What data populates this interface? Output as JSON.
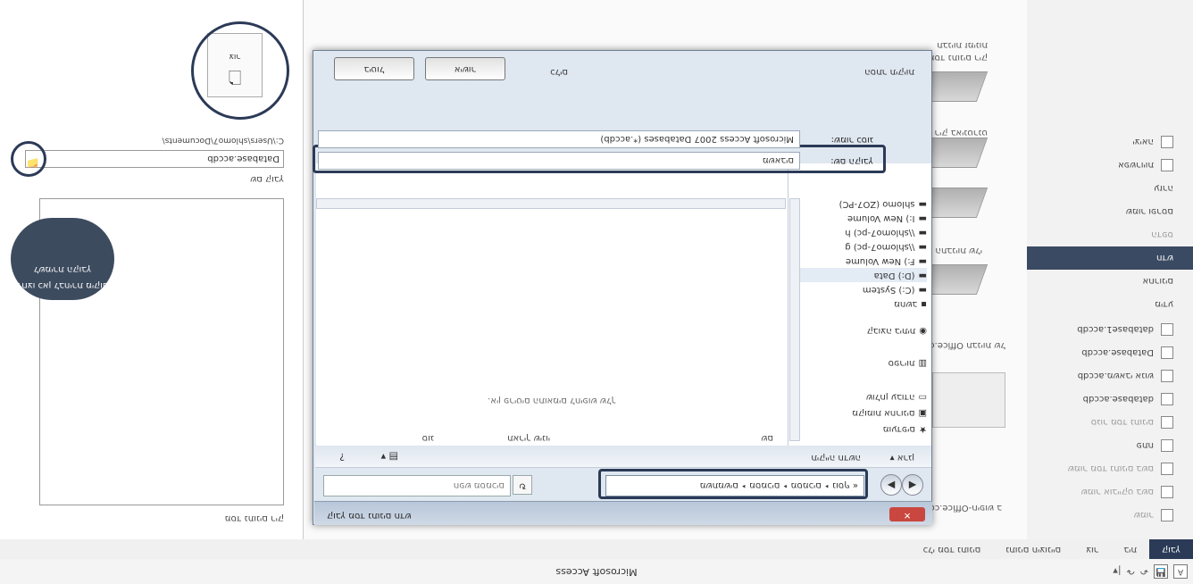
{
  "app_title": "Microsoft Access",
  "quick_access": [
    "A",
    "💾",
    "↶",
    "↷",
    "|▾"
  ],
  "ribbon_tabs": [
    {
      "label": "קובץ",
      "active": true
    },
    {
      "label": "בית"
    },
    {
      "label": "צור"
    },
    {
      "label": "נתונים חיצוניים"
    },
    {
      "label": "כלי מסד נתונים"
    }
  ],
  "left_pane": {
    "items": [
      {
        "label": "שמור",
        "icon": "save-icon"
      },
      {
        "label": "שמור אובייקט בשם",
        "icon": "save-as-icon"
      },
      {
        "label": "שמור מסד נתונים בשם",
        "icon": "save-db-icon"
      },
      {
        "label": "פתח",
        "icon": "open-icon"
      },
      {
        "label": "סגור מסד נתונים",
        "icon": "close-db-icon"
      },
      {
        "label": "database.accdb",
        "icon": "db-file-icon"
      },
      {
        "label": "משאבי אנוש.accdb",
        "icon": "db-file-icon"
      },
      {
        "label": "Database.accdb",
        "icon": "db-file-icon"
      },
      {
        "label": "database1.accdb",
        "icon": "db-file-icon"
      },
      {
        "label": "מידע"
      },
      {
        "label": "אחרונים"
      },
      {
        "label": "חדש",
        "selected": true
      },
      {
        "label": "הדפס"
      },
      {
        "label": "שמור ופרסם"
      },
      {
        "label": "עזרה"
      },
      {
        "label": "אפשרויות"
      },
      {
        "label": "יציאה"
      }
    ]
  },
  "templates": {
    "header": "תבניות זמינות",
    "items": [
      {
        "label": "מסד נתונים ריק"
      },
      {
        "label": "מסד נתונים ריק באינטרנט"
      },
      {
        "label": "תבניות לדוגמה"
      },
      {
        "label": "התבניות שלי"
      }
    ],
    "group_label": "תבניות של Office.com",
    "nav_label": "חיפוש ב-Office.com"
  },
  "right_pane": {
    "title": "מסד נתונים ריק",
    "filename_label": "שם קובץ",
    "filename": "Database.accdb",
    "path": "C:\\Users\\shlomo7\\Documents\\",
    "tooltip": "לחצו כאן לבחירת מיקום לשמירת הקובץ",
    "create_label": "צור"
  },
  "dialog": {
    "title": "קובץ מסד נתונים חדש",
    "close": "✕",
    "address": "« משתמשים ‣ מסמכים ‣ מסמכים ‣ נוסף",
    "search_placeholder": "חפש מסמכים",
    "organize": "ארגן ▾",
    "new_folder": "תיקייה חדשה",
    "columns": [
      "שם",
      "תאריך שינוי",
      "סוג"
    ],
    "empty_text": "אין פריטים התואמים לחיפוש שלך.",
    "nav_items": [
      {
        "label": "מועדפים",
        "icon": "star-icon"
      },
      {
        "label": "מקומות אחרונים",
        "icon": "recent-icon"
      },
      {
        "label": "שולחן עבודה",
        "icon": "desktop-icon"
      },
      {
        "label": "ספריות",
        "icon": "library-icon"
      },
      {
        "label": "קבוצה ביתית",
        "icon": "homegroup-icon"
      },
      {
        "label": "מחשב",
        "icon": "computer-icon"
      },
      {
        "label": "(C:) System",
        "icon": "drive-icon"
      },
      {
        "label": "(D:) Data",
        "icon": "drive-icon"
      },
      {
        "label": "F:) New Volume",
        "icon": "drive-icon"
      },
      {
        "label": "\\\\shlomo7-pc) g",
        "icon": "network-icon"
      },
      {
        "label": "\\\\shlomo7-pc) h",
        "icon": "network-icon"
      },
      {
        "label": "I:) New Volume",
        "icon": "drive-icon"
      },
      {
        "label": "shlomo (ZO7-PC)",
        "icon": "network-icon"
      }
    ],
    "filename_label": "שם הקובץ:",
    "filename_value": "משאבים",
    "filetype_label": "שמור כסוג:",
    "filetype_value": "Microsoft Access 2007 Databases (*.accdb)",
    "hide_folders": "הסתר תיקיות",
    "tools": "כלים",
    "ok": "אישור",
    "cancel": "ביטול"
  }
}
